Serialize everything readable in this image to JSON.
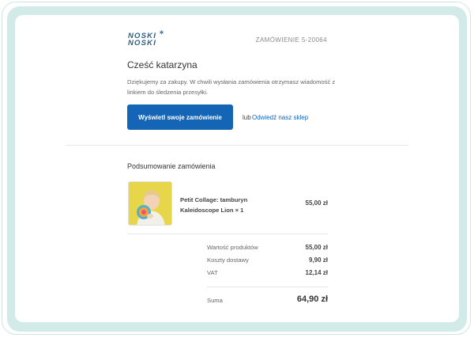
{
  "brand": {
    "logo_line1": "NOSKI",
    "logo_line2": "NOSKI",
    "logo_mark": "✲",
    "color": "#2b5d83"
  },
  "header": {
    "order_number": "ZAMÓWIENIE 5-20064"
  },
  "message": {
    "greeting": "Cześć katarzyna",
    "intro": "Dziękujemy za zakupy. W chwili wysłania zamówienia otrzymasz wiadomość z linkiem do śledzenia przesyłki."
  },
  "actions": {
    "view_order_label": "Wyświetl swoje zamówienie",
    "or_text": "lub",
    "shop_link_label": "Odwiedź nasz sklep",
    "accent_color": "#1565b7"
  },
  "summary": {
    "title": "Podsumowanie zamówienia",
    "items": [
      {
        "name": "Petit Collage: tamburyn Kaleidoscope Lion × 1",
        "price": "55,00 zł",
        "image_icon": "product-photo-child-with-tambourine"
      }
    ],
    "rows": [
      {
        "label": "Wartość produktów",
        "value": "55,00 zł"
      },
      {
        "label": "Koszty dostawy",
        "value": "9,90 zł"
      },
      {
        "label": "VAT",
        "value": "12,14 zł"
      }
    ],
    "total_label": "Suma",
    "total_value": "64,90 zł"
  }
}
